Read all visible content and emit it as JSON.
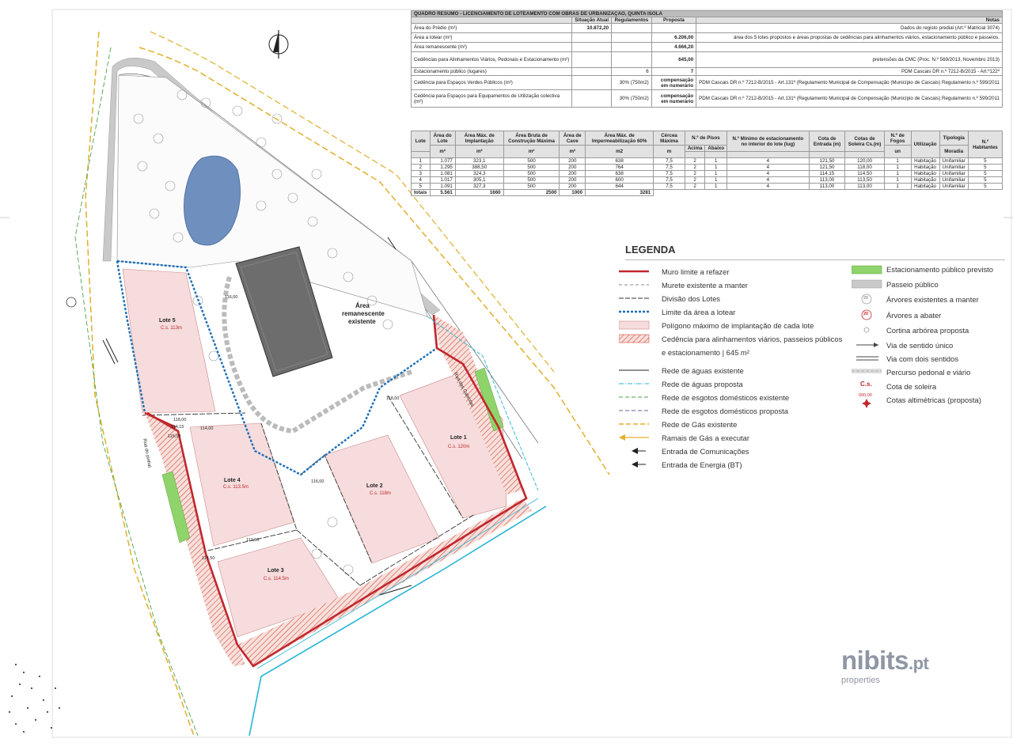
{
  "summary_table": {
    "title": "QUADRO RESUMO - LICENCIAMENTO DE LOTEAMENTO COM OBRAS DE URBANIZAÇÃO, QUINTA ISOLA",
    "headers": [
      "",
      "Situação Atual",
      "Regulamentos",
      "Proposta",
      "Notas"
    ],
    "rows": [
      {
        "label": "Área do Prédio (m²)",
        "atual": "10.872,20",
        "reg": "",
        "prop": "",
        "nota": "Dados do registo predial (Art.º Matricial 3074)"
      },
      {
        "label": "Área a lotear (m²)",
        "atual": "",
        "reg": "",
        "prop": "6.206,00",
        "nota": "área dos 5 lotes propostos e áreas propostas de cedências para alinhamentos viários, estacionamento público e passeios."
      },
      {
        "label": "Área remanescente (m²)",
        "atual": "",
        "reg": "",
        "prop": "4.666,20",
        "nota": ""
      },
      {
        "label": "Cedências para Alinhamentos Viários, Pedonais e Estacionamento (m²)",
        "atual": "",
        "reg": "",
        "prop": "645,00",
        "nota": "pretensões da CMC (Proc. N.º 569/2013, Novembro 2013)"
      },
      {
        "label": "Estacionamento público (lugares)",
        "atual": "",
        "reg": "6",
        "prop": "7",
        "nota": "PDM Cascais DR n.º 7212-B/2015 - Art.º122º"
      },
      {
        "label": "Cedência para Espaços Verdes Públicos (m²)",
        "atual": "",
        "reg": "30% (750m2)",
        "prop": "compensação em numerário",
        "nota": "PDM Cascais DR n.º 7212-B/2015 - Art.131º (Regulamento Municipal de Compensação (Município de Cascais) Regulamento n.º 599/2011"
      },
      {
        "label": "Cedência para Espaços para Equipamentos de Utilização colectiva (m²)",
        "atual": "",
        "reg": "30% (750m2)",
        "prop": "compensação em numerário",
        "nota": "PDM Cascais DR n.º 7212-B/2015 - Art.131º (Regulamento Municipal de Compensação (Município de Cascais) Regulamento n.º 599/2011"
      }
    ]
  },
  "lots_table": {
    "headers": [
      "Lote",
      "Área do Lote",
      "Área Máx. de Implantação",
      "Área Bruta de Construção Máxima",
      "Área de Cave",
      "Área Máx. de Impermeabilização 60%",
      "Cércea Máxima",
      "N.º de Pisos",
      "N.º Mínimo de estacionamento no interior do lote (lug)",
      "Cota de Entrada (m)",
      "Cotas de Soleira Cs.(m)",
      "N.º de Fogos",
      "Utilização",
      "Tipologia",
      "N.º Habitantes"
    ],
    "sub_pisos": [
      "Acima",
      "Abaixo"
    ],
    "sub_tipologia": "Moradia",
    "units": [
      "",
      "m²",
      "m²",
      "m²",
      "m²",
      "m2",
      "m",
      "",
      "",
      "",
      "",
      "",
      "un",
      "",
      "",
      "",
      ""
    ],
    "rows": [
      [
        "1",
        "1.077",
        "323,1",
        "500",
        "200",
        "638",
        "7,5",
        "2",
        "1",
        "4",
        "121,50",
        "120,00",
        "1",
        "Habitação",
        "Unifamiliar",
        "5"
      ],
      [
        "2",
        "1.295",
        "388,50",
        "500",
        "200",
        "764",
        "7,5",
        "2",
        "1",
        "4",
        "121,50",
        "118,00",
        "1",
        "Habitação",
        "Unifamiliar",
        "5"
      ],
      [
        "3",
        "1.081",
        "324,3",
        "500",
        "200",
        "638",
        "7,5",
        "2",
        "1",
        "4",
        "114,15",
        "114,50",
        "1",
        "Habitação",
        "Unifamiliar",
        "5"
      ],
      [
        "4",
        "1.017",
        "305,1",
        "500",
        "200",
        "600",
        "7,5",
        "2",
        "1",
        "4",
        "113,00",
        "113,50",
        "1",
        "Habitação",
        "Unifamiliar",
        "5"
      ],
      [
        "5",
        "1.091",
        "327,3",
        "500",
        "200",
        "644",
        "7,5",
        "2",
        "1",
        "4",
        "113,00",
        "113,00",
        "1",
        "Habitação",
        "Unifamiliar",
        "5"
      ]
    ],
    "totals": [
      "totais",
      "5.561",
      "1660",
      "2500",
      "1000",
      "3281"
    ]
  },
  "legend": {
    "title": "LEGENDA",
    "left": [
      {
        "label": "Muro limite a refazer",
        "sym": "red-line"
      },
      {
        "label": "Murete existente a manter",
        "sym": "thin-dash"
      },
      {
        "label": "Divisão dos Lotes",
        "sym": "dark-dash"
      },
      {
        "label": "Limite da área a lotear",
        "sym": "blue-dotted"
      },
      {
        "label": "Polígono máximo de implantação de cada lote",
        "sym": "pink-box"
      },
      {
        "label": "Cedência para alinhamentos viários, passeios públicos",
        "sym": "hatch-box"
      },
      {
        "label": "e estacionamento | 645 m²",
        "sym": "none"
      },
      {
        "label": "Rede de águas existente",
        "sym": "black-line"
      },
      {
        "label": "Rede de águas proposta",
        "sym": "cyan-dash"
      },
      {
        "label": "Rede de esgotos domésticos existente",
        "sym": "green-dash"
      },
      {
        "label": "Rede de esgotos domésticos proposta",
        "sym": "purple-dash"
      },
      {
        "label": "Rede de Gás existente",
        "sym": "yellow-dash"
      },
      {
        "label": "Ramais de Gás a executar",
        "sym": "yellow-arrow"
      },
      {
        "label": "Entrada de Comunicações",
        "sym": "black-arrow"
      },
      {
        "label": "Entrada de Energia (BT)",
        "sym": "black-arrow"
      }
    ],
    "right": [
      {
        "label": "Estacionamento público previsto",
        "sym": "green-box"
      },
      {
        "label": "Passeio público",
        "sym": "grey-box"
      },
      {
        "label": "Árvores existentes a manter",
        "sym": "tree-circle",
        "mark": "20"
      },
      {
        "label": "Árvores a abater",
        "sym": "tree-red",
        "mark": "20"
      },
      {
        "label": "Cortina arbórea proposta",
        "sym": "small-circle"
      },
      {
        "label": "Via de sentido único",
        "sym": "one-way"
      },
      {
        "label": "Via com dois sentidos",
        "sym": "two-way"
      },
      {
        "label": "Percurso pedonal e viário",
        "sym": "grey-dash"
      },
      {
        "label": "Cota de soleira",
        "sym": "cs",
        "mark": "C.s."
      },
      {
        "label": "Cotas altimétricas (proposta)",
        "sym": "star",
        "mark": "000,00"
      }
    ]
  },
  "plan": {
    "lots": [
      {
        "name": "Lote 5",
        "cs": "C.s. 113m"
      },
      {
        "name": "Lote 4",
        "cs": "C.s. 113.5m"
      },
      {
        "name": "Lote 3",
        "cs": "C.s. 114.5m"
      },
      {
        "name": "Lote 2",
        "cs": "C.s. 118m"
      },
      {
        "name": "Lote 1",
        "cs": "C.s. 120m"
      }
    ],
    "remainder_label": [
      "Área",
      "remanescente",
      "existente"
    ],
    "street_right": "Rua das Galeotas",
    "street_left": "Rua do pinhal",
    "spot_heights": [
      "116,00",
      "118,00",
      "115,00",
      "114,00",
      "113,50",
      "114,50",
      "118,00",
      "116,00",
      "114,15"
    ],
    "north_symbol": "north-arrow"
  },
  "brand": {
    "name": "nibits",
    "suffix": ".pt",
    "sub": "properties"
  },
  "colors": {
    "red": "#c0272d",
    "blue": "#1c6fb8",
    "green": "#8fd46a",
    "pink": "#f6dcdc",
    "cyan": "#26b4d6",
    "yellow": "#e0b02a",
    "grey": "#c9c9c9"
  }
}
